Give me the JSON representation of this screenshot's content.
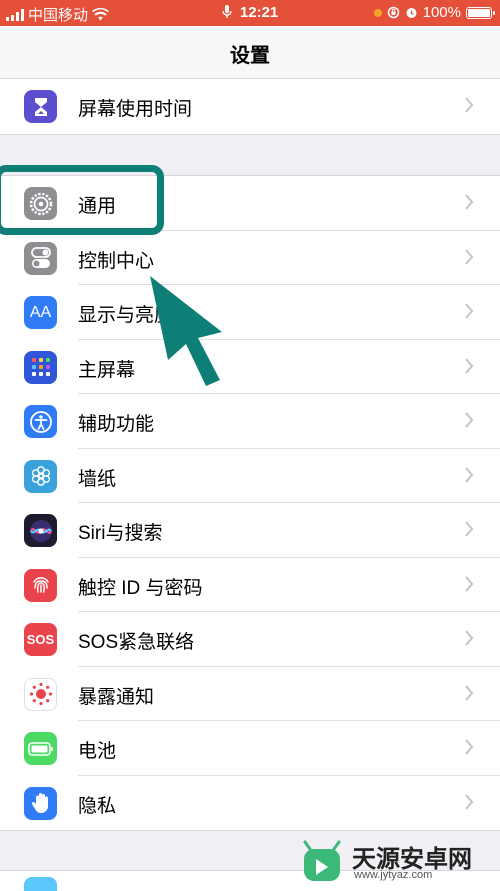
{
  "status_bar": {
    "carrier": "中国移动",
    "time": "12:21",
    "battery": "100%"
  },
  "nav": {
    "title": "设置"
  },
  "groups": [
    {
      "items": [
        {
          "label": "屏幕使用时间",
          "icon": "hourglass-icon",
          "color": "#5b4fcf"
        }
      ]
    },
    {
      "items": [
        {
          "label": "通用",
          "icon": "gear-icon",
          "color": "#8e8e93"
        },
        {
          "label": "控制中心",
          "icon": "toggles-icon",
          "color": "#8e8e93"
        },
        {
          "label": "显示与亮度",
          "icon": "text-size-icon",
          "color": "#2f7cf6"
        },
        {
          "label": "主屏幕",
          "icon": "app-grid-icon",
          "color": "#2f56d6"
        },
        {
          "label": "辅助功能",
          "icon": "accessibility-icon",
          "color": "#2f7cf6"
        },
        {
          "label": "墙纸",
          "icon": "flower-icon",
          "color": "#3aa2d8"
        },
        {
          "label": "Siri与搜索",
          "icon": "siri-icon",
          "color": "#1c1c2e"
        },
        {
          "label": "触控 ID 与密码",
          "icon": "fingerprint-icon",
          "color": "#e9434b"
        },
        {
          "label": "SOS紧急联络",
          "icon": "sos-icon",
          "color": "#e9434b"
        },
        {
          "label": "暴露通知",
          "icon": "exposure-icon",
          "color": "#ffffff"
        },
        {
          "label": "电池",
          "icon": "battery-icon",
          "color": "#4cd964"
        },
        {
          "label": "隐私",
          "icon": "hand-icon",
          "color": "#2f7cf6"
        }
      ]
    }
  ],
  "sos_text": "SOS",
  "text_size_text": "AA",
  "annotation": {
    "highlight_color": "#0e7f77"
  },
  "watermark": {
    "title": "天源安卓网",
    "url": "www.jytyaz.com"
  }
}
